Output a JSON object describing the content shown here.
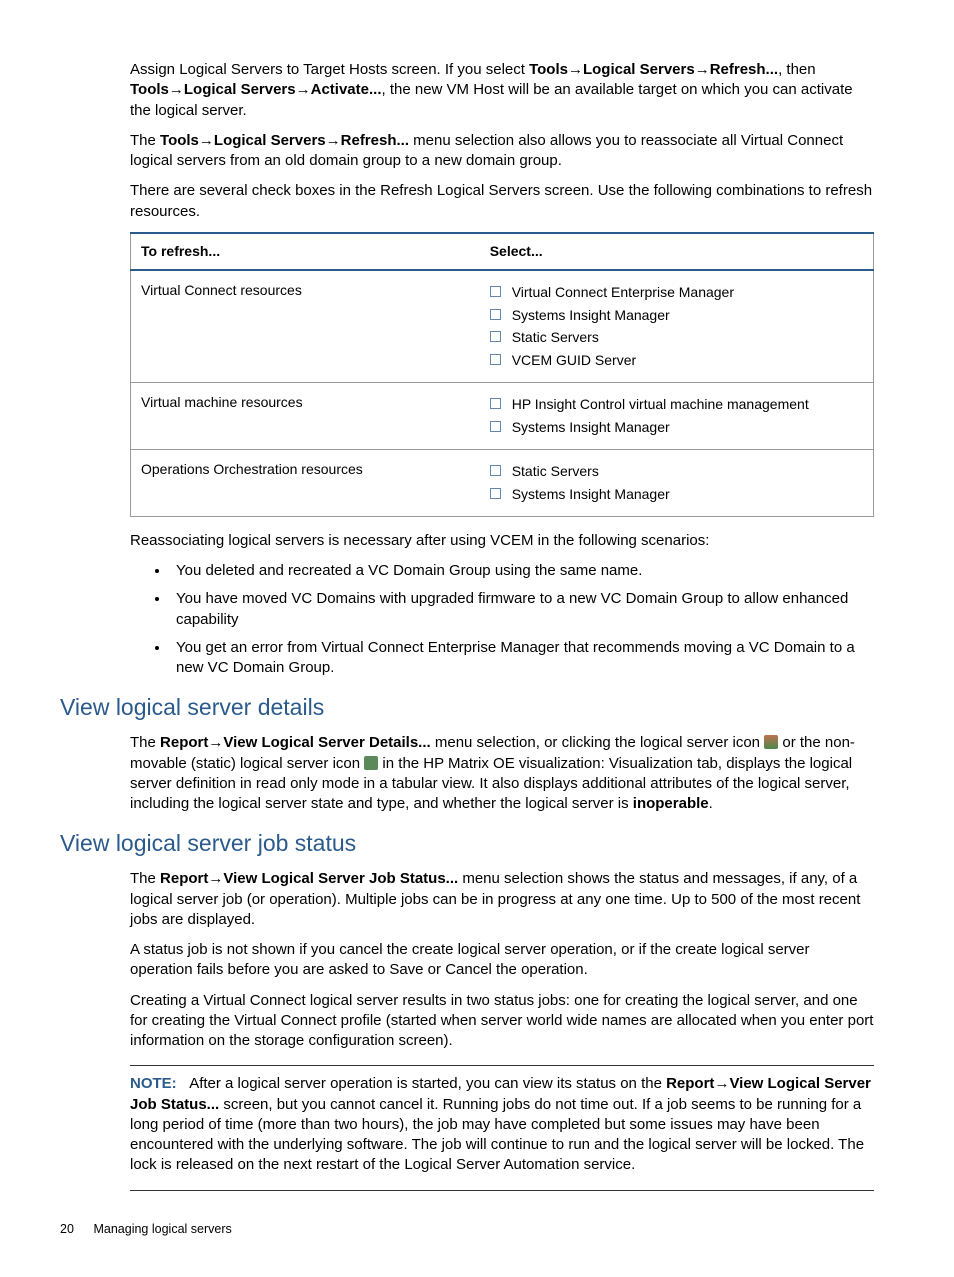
{
  "para1": {
    "pre": "Assign Logical Servers to Target Hosts screen. If you select ",
    "menu1a": "Tools",
    "menu1b": "Logical Servers",
    "menu1c": "Refresh...",
    "mid1": ", then ",
    "menu2a": "Tools",
    "menu2b": "Logical Servers",
    "menu2c": "Activate...",
    "post": ", the new VM Host will be an available target on which you can activate the logical server."
  },
  "para2": {
    "pre": "The ",
    "m1": "Tools",
    "m2": "Logical Servers",
    "m3": "Refresh...",
    "post": " menu selection also allows you to reassociate all Virtual Connect logical servers from an old domain group to a new domain group."
  },
  "para3": "There are several check boxes in the Refresh Logical Servers screen. Use the following combinations to refresh resources.",
  "table": {
    "h1": "To refresh...",
    "h2": "Select...",
    "rows": [
      {
        "left": "Virtual Connect resources",
        "items": [
          "Virtual Connect Enterprise Manager",
          "Systems Insight Manager",
          "Static Servers",
          "VCEM GUID Server"
        ]
      },
      {
        "left": "Virtual machine resources",
        "items": [
          "HP Insight Control virtual machine management",
          "Systems Insight Manager"
        ]
      },
      {
        "left": "Operations Orchestration resources",
        "items": [
          "Static Servers",
          "Systems Insight Manager"
        ]
      }
    ]
  },
  "para4": "Reassociating logical servers is necessary after using VCEM in the following scenarios:",
  "bullets": [
    "You deleted and recreated a VC Domain Group using the same name.",
    "You have moved  VC Domains with upgraded firmware to a new VC Domain Group to allow enhanced capability",
    "You get an error from Virtual Connect Enterprise Manager that recommends moving a VC Domain to a new VC Domain Group."
  ],
  "h_details": "View logical server details",
  "details": {
    "pre": "The ",
    "m1": "Report",
    "m2": "View Logical Server Details...",
    "mid1": " menu selection, or clicking the logical server icon ",
    "mid2": " or the non-movable (static) logical server icon ",
    "mid3": " in the HP Matrix OE visualization: Visualization tab, displays the logical server definition in read only mode in a tabular view. It also displays additional attributes of the logical server, including the logical server state and type, and whether the logical server is ",
    "inop": "inoperable",
    "post": "."
  },
  "h_status": "View logical server job status",
  "status_p1": {
    "pre": "The ",
    "m1": "Report",
    "m2": "View Logical Server Job Status...",
    "post": " menu selection shows the status and messages, if any, of a logical server job (or operation). Multiple jobs can be in progress at any one time. Up to 500 of the most recent jobs are displayed."
  },
  "status_p2": "A status job is not shown if you cancel the create logical server operation, or if the create logical server operation fails before you are asked to Save or Cancel the operation.",
  "status_p3": "Creating a Virtual Connect logical server results in two status jobs: one for creating the logical server, and one for creating the Virtual Connect profile (started when server world wide names are allocated when you enter port information on the storage configuration screen).",
  "note": {
    "label": "NOTE:",
    "pre": "After a logical server operation is started, you can view its status on the ",
    "m1": "Report",
    "m2": "View Logical Server Job Status...",
    "post": " screen, but you cannot cancel it. Running jobs do not time out. If a job seems to be running for a long period of time (more than two hours), the job may have completed but some issues may have been encountered with the underlying software. The job will continue to run and the logical server will be locked. The lock is released on the next restart of the Logical Server Automation service."
  },
  "footer": {
    "page": "20",
    "title": "Managing logical servers"
  }
}
